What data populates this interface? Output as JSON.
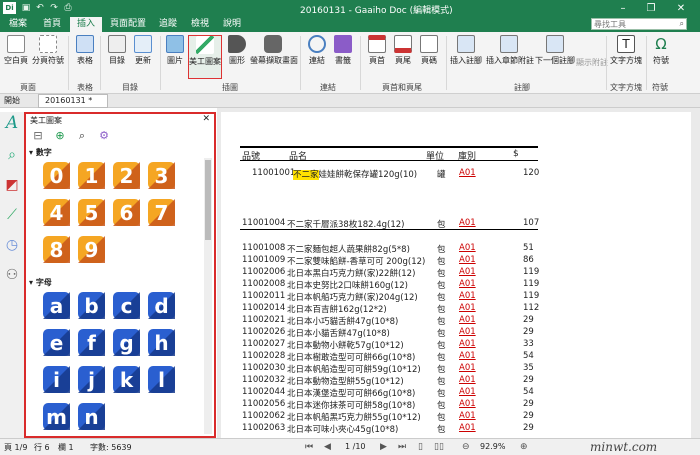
{
  "titlebar": {
    "title": "20160131 - Gaaiho Doc (編輯模式)",
    "logo": "Di"
  },
  "menu": {
    "tabs": [
      "檔案",
      "首頁",
      "插入",
      "頁面配置",
      "追蹤",
      "檢視",
      "說明"
    ],
    "active": "插入",
    "search_placeholder": "尋找工具"
  },
  "ribbon": {
    "buttons": [
      "空白頁",
      "分頁符號",
      "表格",
      "目錄",
      "更新",
      "圖片",
      "美工圖案",
      "圖形",
      "螢幕擷取畫面",
      "連結",
      "書籤",
      "頁首",
      "頁尾",
      "頁碼",
      "插入註腳",
      "插入章節附註",
      "下一個註腳",
      "顯示附註",
      "文字方塊",
      "符號"
    ],
    "selected": "美工圖案",
    "groups": [
      "頁面",
      "表格",
      "目錄",
      "插圖",
      "連結",
      "頁首和頁尾",
      "註腳",
      "文字方塊",
      "符號"
    ]
  },
  "tabs": {
    "start": "開始",
    "document": "20160131 *"
  },
  "panel": {
    "title": "美工圖案",
    "section_numbers": "數字",
    "section_letters": "字母",
    "numbers": [
      "0",
      "1",
      "2",
      "3",
      "4",
      "5",
      "6",
      "7",
      "8",
      "9"
    ],
    "letters": [
      "a",
      "b",
      "c",
      "d",
      "e",
      "f",
      "g",
      "h",
      "i",
      "j",
      "k",
      "l",
      "m",
      "n"
    ]
  },
  "table": {
    "headers": {
      "code": "品號",
      "name": "品名",
      "unit": "單位",
      "category": "庫別",
      "price": "$"
    },
    "first_row": {
      "code": "11001001",
      "highlight": "不二家",
      "rest": "娃娃餅乾保存罐120g(10)",
      "unit": "罐",
      "category": "A01",
      "price": "120"
    },
    "rows": [
      {
        "code": "11001004",
        "name": "不二家千層派38枚182.4g(12)",
        "unit": "包",
        "category": "A01",
        "price": "107"
      },
      {
        "code": "11001008",
        "name": "不二家麵包超人蔬果餅82g(5*8)",
        "unit": "包",
        "category": "A01",
        "price": "51"
      },
      {
        "code": "11001009",
        "name": "不二家雙味餡餅-香草可可 200g(12)",
        "unit": "包",
        "category": "A01",
        "price": "86"
      },
      {
        "code": "11002006",
        "name": "北日本黑白巧克力餅(家)22餅(12)",
        "unit": "包",
        "category": "A01",
        "price": "119"
      },
      {
        "code": "11002008",
        "name": "北日本史努比2口味餅160g(12)",
        "unit": "包",
        "category": "A01",
        "price": "119"
      },
      {
        "code": "11002011",
        "name": "北日本帆船巧克力餅(家)204g(12)",
        "unit": "包",
        "category": "A01",
        "price": "119"
      },
      {
        "code": "11002014",
        "name": "北日本百吉餅162g(12*2)",
        "unit": "包",
        "category": "A01",
        "price": "112"
      },
      {
        "code": "11002021",
        "name": "北日本小巧貓舌餅47g(10*8)",
        "unit": "包",
        "category": "A01",
        "price": "29"
      },
      {
        "code": "11002026",
        "name": "北日本小貓舌餅47g(10*8)",
        "unit": "包",
        "category": "A01",
        "price": "29"
      },
      {
        "code": "11002027",
        "name": "北日本動物小餅乾57g(10*12)",
        "unit": "包",
        "category": "A01",
        "price": "33"
      },
      {
        "code": "11002028",
        "name": "北日本樹敢造型可可餅66g(10*8)",
        "unit": "包",
        "category": "A01",
        "price": "54"
      },
      {
        "code": "11002030",
        "name": "北日本帆船造型可可餅59g(10*12)",
        "unit": "包",
        "category": "A01",
        "price": "35"
      },
      {
        "code": "11002032",
        "name": "北日本動物造型餅55g(10*12)",
        "unit": "包",
        "category": "A01",
        "price": "29"
      },
      {
        "code": "11002044",
        "name": "北日本漢堡造型可可餅66g(10*8)",
        "unit": "包",
        "category": "A01",
        "price": "54"
      },
      {
        "code": "11002056",
        "name": "北日本迷你抹茶可可餅58g(10*8)",
        "unit": "包",
        "category": "A01",
        "price": "29"
      },
      {
        "code": "11002062",
        "name": "北日本帆船黑巧克力餅55g(10*12)",
        "unit": "包",
        "category": "A01",
        "price": "29"
      },
      {
        "code": "11002063",
        "name": "北日本可味小夾心45g(10*8)",
        "unit": "包",
        "category": "A01",
        "price": "29"
      }
    ]
  },
  "status": {
    "page": "頁 1/9",
    "line": "行 6",
    "column": "欄 1",
    "words": "字數: 5639",
    "page_nav": "1 /10",
    "zoom": "92.9%"
  },
  "watermark": "minwt.com",
  "colors": {
    "brand": "#1f7f4f",
    "orange": "#f5a623",
    "blue": "#2255c4"
  }
}
